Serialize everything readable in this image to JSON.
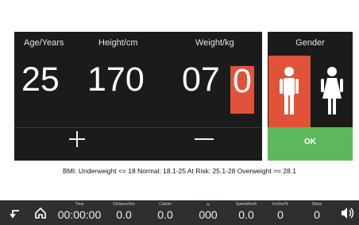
{
  "header": {
    "age_label": "Age/Years",
    "height_label": "Height/cm",
    "weight_label": "Weight/kg",
    "gender_label": "Gender"
  },
  "values": {
    "age": "25",
    "height": "170",
    "weight_prefix": "07",
    "weight_active_digit": "0"
  },
  "controls": {
    "ok_label": "OK"
  },
  "bmi_note": "BMI: Underweight <= 18 Normal: 18.1-25 At Risk: 25.1-28 Overweight >= 28.1",
  "bottom_bar": {
    "stats": [
      {
        "label": "Time",
        "value": "00:00:00"
      },
      {
        "label": "Distance/km",
        "value": "0.0"
      },
      {
        "label": "Calorie",
        "value": "0.0"
      },
      {
        "label": "",
        "value": "000"
      },
      {
        "label": "Speed/km/h",
        "value": "0.0"
      },
      {
        "label": "Incline/%",
        "value": "0"
      },
      {
        "label": "Steps",
        "value": "0"
      }
    ]
  },
  "colors": {
    "accent": "#e05338",
    "ok": "#5cb85c",
    "panel": "#1b1b1b",
    "bar": "#2f2f2f"
  },
  "icons": [
    "back-icon",
    "home-icon",
    "heart-icon",
    "volume-icon",
    "plus-icon",
    "minus-icon",
    "male-icon",
    "female-icon"
  ]
}
